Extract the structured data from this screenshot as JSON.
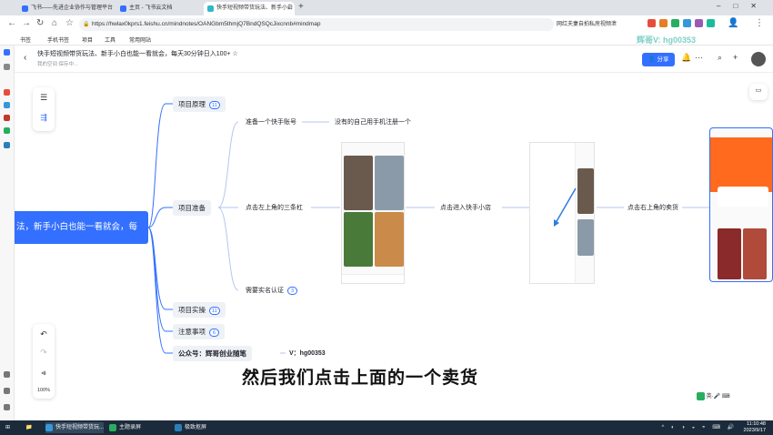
{
  "browser": {
    "tabs": [
      {
        "label": "飞书——先进企业协作与管理平台",
        "active": false
      },
      {
        "label": "主页 - 飞书云文档",
        "active": false
      },
      {
        "label": "快手短视频带货玩法、新手小白",
        "active": true
      }
    ],
    "url": "https://hwlax0kprs1.feishu.cn/mindnotes/OANGbm5thmjQ7BndQSQcJixcnnb#mindmap",
    "addr_right_text": "网红夫妻自拍私房视频泄",
    "bookmarks": [
      "书签",
      "手机书签",
      "项目",
      "工具",
      "常用网站"
    ],
    "watermark": "辉哥V: hg00353"
  },
  "doc": {
    "title": "快手短视频带货玩法、新手小白也能一看就会，每天30分钟日入100+",
    "subtitle_left": "我的空间",
    "subtitle_right": "保存中...",
    "share_label": "分享"
  },
  "toolbox": {
    "zoom": "100%"
  },
  "mindmap": {
    "root": "法，新手小白也能一看就会，每",
    "level1": [
      {
        "label": "项目原理",
        "badge": "11"
      },
      {
        "label": "项目准备",
        "badge": ""
      },
      {
        "label": "项目实操",
        "badge": "11"
      },
      {
        "label": "注意事项",
        "badge": "6"
      },
      {
        "label": "公众号：辉哥创业随笔",
        "badge": ""
      }
    ],
    "wechat": "V：hg00353",
    "prep": {
      "account": "准备一个快手账号",
      "account_child": "没有的自己用手机注册一个",
      "step1": "点击左上角的三条杠",
      "step2": "点击进入快手小店",
      "step3": "点击右上角的卖货",
      "verify": "需要实名认证",
      "verify_badge": "3"
    }
  },
  "caption": "然后我们点击上面的一个卖货",
  "sys_badge": "英·🎤 ⌨",
  "taskbar": {
    "items": [
      "快手短视频带货玩...",
      "主题录屏",
      "极致抠屏"
    ],
    "time": "11:10:48",
    "date": "2023/9/17"
  }
}
